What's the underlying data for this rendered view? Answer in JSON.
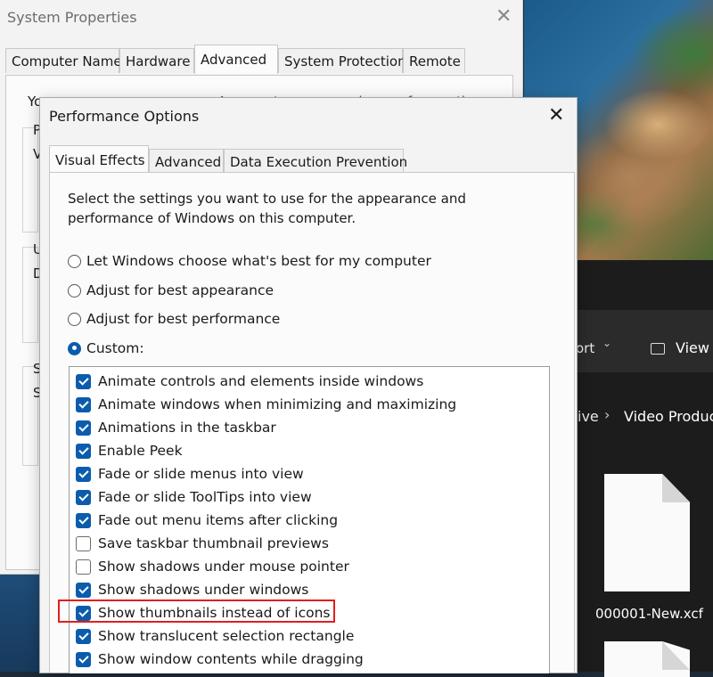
{
  "system_properties": {
    "title": "System Properties",
    "close_glyph": "✕",
    "tabs": [
      "Computer Name",
      "Hardware",
      "Advanced",
      "System Protection",
      "Remote"
    ],
    "active_tab": "Advanced",
    "partial_texts": [
      "Yo",
      "A",
      "t",
      "d",
      "f",
      "th",
      "P",
      "V",
      "U",
      "D",
      "S",
      "S"
    ]
  },
  "performance_options": {
    "title": "Performance Options",
    "close_glyph": "✕",
    "tabs": [
      "Visual Effects",
      "Advanced",
      "Data Execution Prevention"
    ],
    "active_tab": "Visual Effects",
    "description": "Select the settings you want to use for the appearance and performance of Windows on this computer.",
    "radio_options": [
      {
        "label": "Let Windows choose what's best for my computer",
        "selected": false
      },
      {
        "label": "Adjust for best appearance",
        "selected": false
      },
      {
        "label": "Adjust for best performance",
        "selected": false
      },
      {
        "label": "Custom:",
        "selected": true
      }
    ],
    "effects": [
      {
        "label": "Animate controls and elements inside windows",
        "checked": true
      },
      {
        "label": "Animate windows when minimizing and maximizing",
        "checked": true
      },
      {
        "label": "Animations in the taskbar",
        "checked": true
      },
      {
        "label": "Enable Peek",
        "checked": true
      },
      {
        "label": "Fade or slide menus into view",
        "checked": true
      },
      {
        "label": "Fade or slide ToolTips into view",
        "checked": true
      },
      {
        "label": "Fade out menu items after clicking",
        "checked": true
      },
      {
        "label": "Save taskbar thumbnail previews",
        "checked": false
      },
      {
        "label": "Show shadows under mouse pointer",
        "checked": false
      },
      {
        "label": "Show shadows under windows",
        "checked": true
      },
      {
        "label": "Show thumbnails instead of icons",
        "checked": true,
        "highlighted": true
      },
      {
        "label": "Show translucent selection rectangle",
        "checked": true
      },
      {
        "label": "Show window contents while dragging",
        "checked": true
      }
    ],
    "highlight_color": "#e01e1e",
    "accent_color": "#0b5cad"
  },
  "file_explorer": {
    "sort_label": "ort",
    "sort_chevron": "⌄",
    "view_label": "View",
    "breadcrumb_prev": "ive",
    "breadcrumb_sep": "›",
    "breadcrumb_current": "Video Produc",
    "file_name": "000001-New.xcf"
  }
}
